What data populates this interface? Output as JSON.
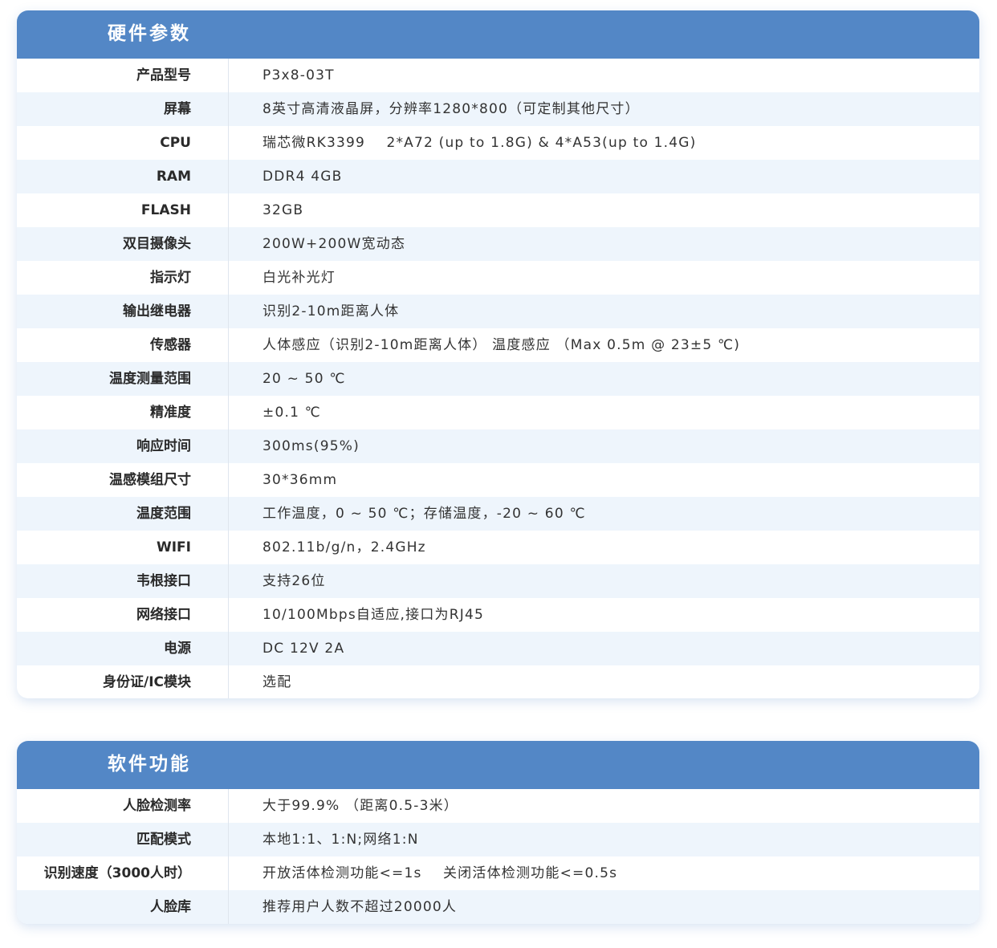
{
  "hardware": {
    "title": "硬件参数",
    "rows": [
      {
        "label": "产品型号",
        "value": "P3x8-03T"
      },
      {
        "label": "屏幕",
        "value": "8英寸高清液晶屏，分辨率1280*800（可定制其他尺寸）"
      },
      {
        "label": "CPU",
        "value": "瑞芯微RK3399    2*A72 (up to 1.8G) & 4*A53(up to 1.4G)"
      },
      {
        "label": "RAM",
        "value": "DDR4 4GB"
      },
      {
        "label": "FLASH",
        "value": "32GB"
      },
      {
        "label": "双目摄像头",
        "value": "200W+200W宽动态"
      },
      {
        "label": "指示灯",
        "value": "白光补光灯"
      },
      {
        "label": "输出继电器",
        "value": "识别2-10m距离人体"
      },
      {
        "label": "传感器",
        "value": "人体感应（识别2-10m距离人体） 温度感应 （Max 0.5m @ 23±5 ℃)"
      },
      {
        "label": "温度测量范围",
        "value": "20 ~ 50 ℃"
      },
      {
        "label": "精准度",
        "value": "±0.1 ℃"
      },
      {
        "label": "响应时间",
        "value": "300ms(95%)"
      },
      {
        "label": "温感模组尺寸",
        "value": "30*36mm"
      },
      {
        "label": "温度范围",
        "value": "工作温度，0 ~ 50 ℃；存储温度，-20 ~ 60 ℃"
      },
      {
        "label": "WIFI",
        "value": "802.11b/g/n，2.4GHz"
      },
      {
        "label": "韦根接口",
        "value": "支持26位"
      },
      {
        "label": "网络接口",
        "value": "10/100Mbps自适应,接口为RJ45"
      },
      {
        "label": "电源",
        "value": "DC 12V 2A"
      },
      {
        "label": "身份证/IC模块",
        "value": "选配"
      }
    ]
  },
  "software": {
    "title": "软件功能",
    "rows": [
      {
        "label": "人脸检测率",
        "value": "大于99.9% （距离0.5-3米）"
      },
      {
        "label": "匹配模式",
        "value": "本地1:1、1:N;网络1:N"
      },
      {
        "label": "识别速度（3000人时）",
        "value": "开放活体检测功能<=1s    关闭活体检测功能<=0.5s"
      },
      {
        "label": "人脸库",
        "value": "推荐用户人数不超过20000人"
      }
    ]
  },
  "colors": {
    "header": "#5387c6",
    "stripe": "#eef5fc",
    "border": "#dfe6ee"
  }
}
